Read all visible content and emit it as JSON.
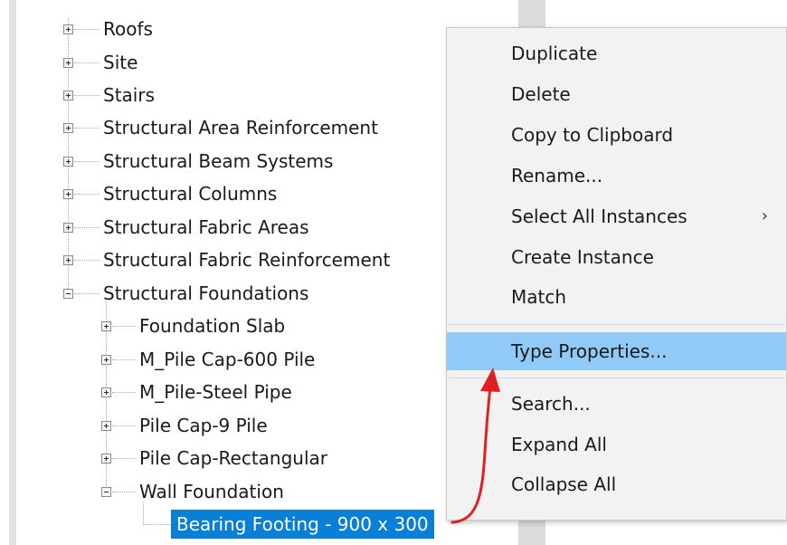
{
  "tree": {
    "items": [
      {
        "label": "Roofs",
        "expanded": false
      },
      {
        "label": "Site",
        "expanded": false
      },
      {
        "label": "Stairs",
        "expanded": false
      },
      {
        "label": "Structural Area Reinforcement",
        "expanded": false
      },
      {
        "label": "Structural Beam Systems",
        "expanded": false
      },
      {
        "label": "Structural Columns",
        "expanded": false
      },
      {
        "label": "Structural Fabric Areas",
        "expanded": false
      },
      {
        "label": "Structural Fabric Reinforcement",
        "expanded": false
      },
      {
        "label": "Structural Foundations",
        "expanded": true
      }
    ],
    "children": [
      {
        "label": "Foundation Slab",
        "expanded": false
      },
      {
        "label": "M_Pile Cap-600 Pile",
        "expanded": false
      },
      {
        "label": "M_Pile-Steel Pipe",
        "expanded": false
      },
      {
        "label": "Pile Cap-9 Pile",
        "expanded": false
      },
      {
        "label": "Pile Cap-Rectangular",
        "expanded": false
      },
      {
        "label": "Wall Foundation",
        "expanded": true
      }
    ],
    "selected_leaf": "Bearing Footing - 900 x 300"
  },
  "context_menu": {
    "items": [
      {
        "label": "Duplicate"
      },
      {
        "label": "Delete"
      },
      {
        "label": "Copy to Clipboard"
      },
      {
        "label": "Rename..."
      },
      {
        "label": "Select All Instances",
        "submenu": "›"
      },
      {
        "label": "Create Instance"
      },
      {
        "label": "Match"
      },
      {
        "label": "Type Properties...",
        "highlighted": true
      },
      {
        "label": "Search..."
      },
      {
        "label": "Expand All"
      },
      {
        "label": "Collapse All"
      }
    ]
  },
  "colors": {
    "selection": "#0a7fd8",
    "menu_highlight": "#91c9f7",
    "annotation_arrow": "#e02020"
  }
}
